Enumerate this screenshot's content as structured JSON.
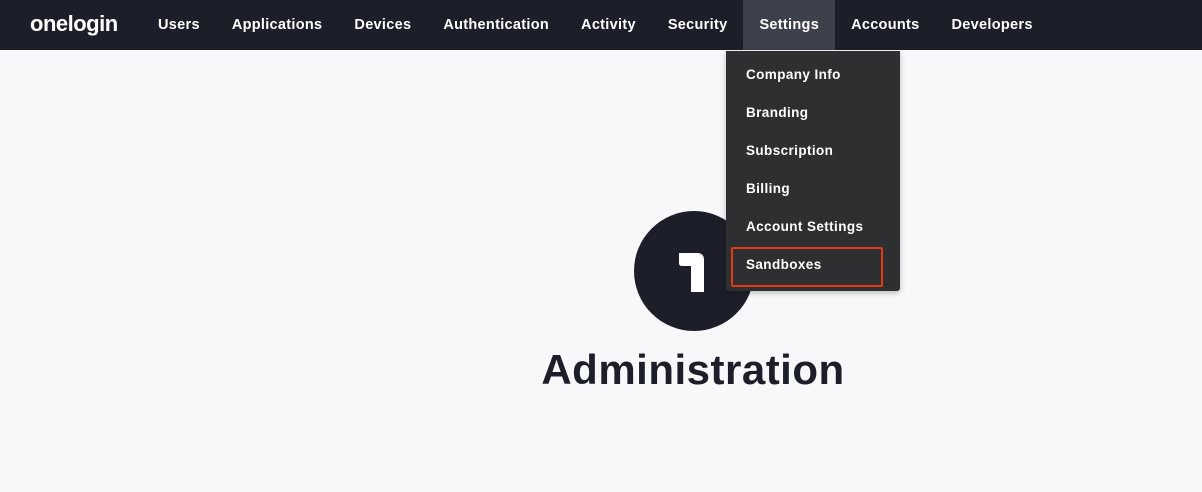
{
  "brand": {
    "logo_text": "onelogin"
  },
  "nav": {
    "items": [
      {
        "label": "Users"
      },
      {
        "label": "Applications"
      },
      {
        "label": "Devices"
      },
      {
        "label": "Authentication"
      },
      {
        "label": "Activity"
      },
      {
        "label": "Security"
      },
      {
        "label": "Settings",
        "active": true
      },
      {
        "label": "Accounts"
      },
      {
        "label": "Developers"
      }
    ]
  },
  "settings_menu": {
    "items": [
      {
        "label": "Company Info"
      },
      {
        "label": "Branding"
      },
      {
        "label": "Subscription"
      },
      {
        "label": "Billing"
      },
      {
        "label": "Account Settings"
      },
      {
        "label": "Sandboxes",
        "highlighted": true
      }
    ],
    "highlight_color": "#e23a12"
  },
  "main": {
    "title": "Administration",
    "badge_icon": "onelogin-1-icon"
  },
  "colors": {
    "topbar": "#1c1f2a",
    "active_nav": "#3d414c",
    "dropdown": "#2e2f31",
    "page_background": "#f7f8fa"
  }
}
